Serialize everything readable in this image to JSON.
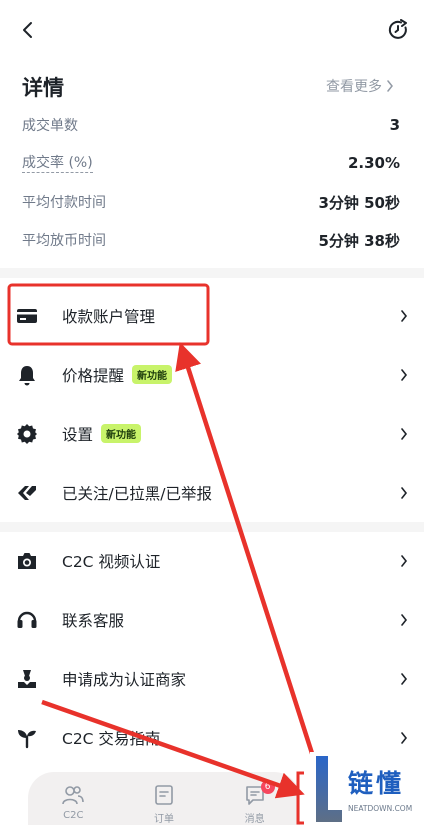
{
  "header": {
    "back_icon": "chevron-left-icon",
    "refresh_icon": "refresh-clock-icon"
  },
  "details": {
    "title": "详情",
    "see_more": "查看更多",
    "stats": [
      {
        "label": "成交单数",
        "value": "3"
      },
      {
        "label": "成交率 (%)",
        "value": "2.30%"
      },
      {
        "label": "平均付款时间",
        "value": "3分钟 50秒"
      },
      {
        "label": "平均放币时间",
        "value": "5分钟 38秒"
      }
    ]
  },
  "menu": {
    "items": [
      {
        "label": "收款账户管理",
        "icon": "card-icon"
      },
      {
        "label": "价格提醒",
        "icon": "bell-icon",
        "badge": "新功能"
      },
      {
        "label": "设置",
        "icon": "gear-icon",
        "badge": "新功能"
      },
      {
        "label": "已关注/已拉黑/已举报",
        "icon": "tag-icon"
      }
    ],
    "items2": [
      {
        "label": "C2C 视频认证",
        "icon": "camera-icon"
      },
      {
        "label": "联系客服",
        "icon": "headset-icon"
      },
      {
        "label": "申请成为认证商家",
        "icon": "merchant-icon"
      },
      {
        "label": "C2C 交易指南",
        "icon": "sprout-icon"
      }
    ]
  },
  "tabbar": {
    "tabs": [
      {
        "label": "C2C",
        "icon": "users-icon"
      },
      {
        "label": "订单",
        "icon": "order-icon"
      },
      {
        "label": "消息",
        "icon": "message-icon",
        "badge": "6"
      }
    ]
  },
  "watermark": {
    "brand": "链懂",
    "domain": "NEATDOWN.COM"
  },
  "colors": {
    "annotation_red": "#e8322b",
    "badge_bg": "#c8f36a"
  }
}
